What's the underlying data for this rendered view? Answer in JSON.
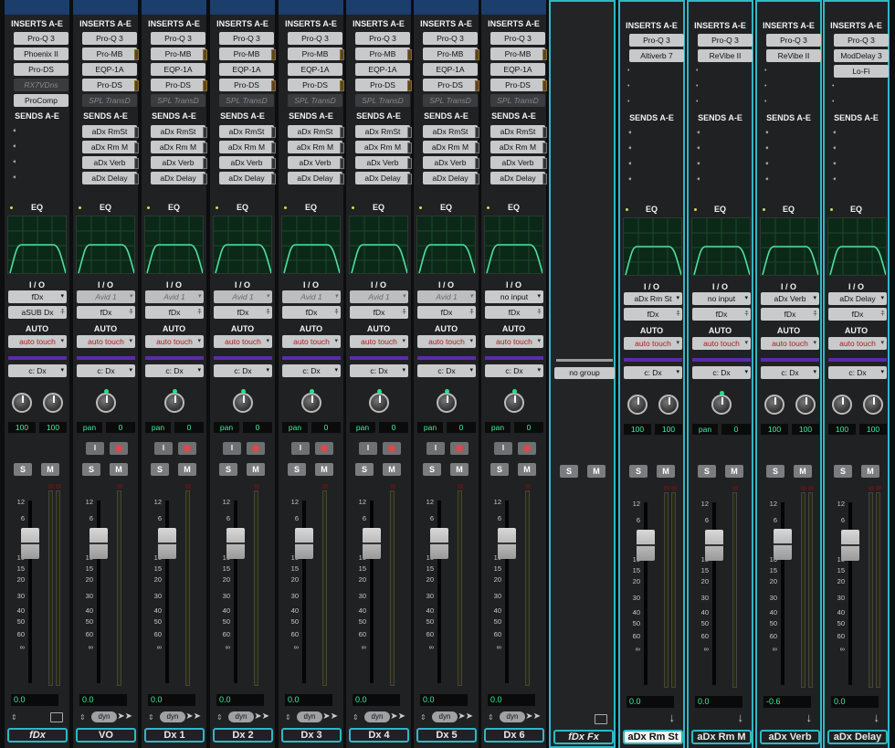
{
  "labels": {
    "inserts": "INSERTS A-E",
    "sends": "SENDS A-E",
    "eq": "EQ",
    "io": "I / O",
    "auto": "AUTO",
    "auto_mode": "auto touch",
    "vca": "c: Dx",
    "pan": "pan",
    "pan_val": "0",
    "lr": "100",
    "solo": "S",
    "mute": "M",
    "input": "I",
    "dyn": "dyn",
    "group": "no group"
  },
  "scale_ticks": [
    "12",
    "6",
    "0",
    "5",
    "10",
    "15",
    "20",
    "30",
    "40",
    "50",
    "60",
    "∞"
  ],
  "strips": [
    {
      "name": "fDx",
      "inserts": [
        "Pro-Q 3",
        "Phoenix II",
        "Pro-DS",
        "RX7VDns",
        "ProComp"
      ],
      "ins_off": [
        false,
        false,
        false,
        true,
        false
      ],
      "sends": [],
      "io_in": "fDx",
      "io_out": "aSUB Dx",
      "io_in_dis": false,
      "stereo": true,
      "vol": "0.0",
      "fader": 0.0
    },
    {
      "name": "VO",
      "inserts": [
        "Pro-Q 3",
        "Pro-MB",
        "EQP-1A",
        "Pro-DS",
        "SPL TransD"
      ],
      "ins_off": [
        false,
        false,
        false,
        false,
        true
      ],
      "sends": [
        "aDx RmSt",
        "aDx Rm M",
        "aDx Verb",
        "aDx Delay"
      ],
      "io_in": "Avid 1",
      "io_out": "fDx",
      "io_in_dis": true,
      "stereo": false,
      "vol": "0.0",
      "fader": 0.0
    },
    {
      "name": "Dx 1",
      "inserts": [
        "Pro-Q 3",
        "Pro-MB",
        "EQP-1A",
        "Pro-DS",
        "SPL TransD"
      ],
      "ins_off": [
        false,
        false,
        false,
        false,
        true
      ],
      "sends": [
        "aDx RmSt",
        "aDx Rm M",
        "aDx Verb",
        "aDx Delay"
      ],
      "io_in": "Avid 1",
      "io_out": "fDx",
      "io_in_dis": true,
      "stereo": false,
      "vol": "0.0",
      "fader": 0.0
    },
    {
      "name": "Dx 2",
      "inserts": [
        "Pro-Q 3",
        "Pro-MB",
        "EQP-1A",
        "Pro-DS",
        "SPL TransD"
      ],
      "ins_off": [
        false,
        false,
        false,
        false,
        true
      ],
      "sends": [
        "aDx RmSt",
        "aDx Rm M",
        "aDx Verb",
        "aDx Delay"
      ],
      "io_in": "Avid 1",
      "io_out": "fDx",
      "io_in_dis": true,
      "stereo": false,
      "vol": "0.0",
      "fader": 0.0
    },
    {
      "name": "Dx 3",
      "inserts": [
        "Pro-Q 3",
        "Pro-MB",
        "EQP-1A",
        "Pro-DS",
        "SPL TransD"
      ],
      "ins_off": [
        false,
        false,
        false,
        false,
        true
      ],
      "sends": [
        "aDx RmSt",
        "aDx Rm M",
        "aDx Verb",
        "aDx Delay"
      ],
      "io_in": "Avid 1",
      "io_out": "fDx",
      "io_in_dis": true,
      "stereo": false,
      "vol": "0.0",
      "fader": 0.0
    },
    {
      "name": "Dx 4",
      "inserts": [
        "Pro-Q 3",
        "Pro-MB",
        "EQP-1A",
        "Pro-DS",
        "SPL TransD"
      ],
      "ins_off": [
        false,
        false,
        false,
        false,
        true
      ],
      "sends": [
        "aDx RmSt",
        "aDx Rm M",
        "aDx Verb",
        "aDx Delay"
      ],
      "io_in": "Avid 1",
      "io_out": "fDx",
      "io_in_dis": true,
      "stereo": false,
      "vol": "0.0",
      "fader": 0.0
    },
    {
      "name": "Dx 5",
      "inserts": [
        "Pro-Q 3",
        "Pro-MB",
        "EQP-1A",
        "Pro-DS",
        "SPL TransD"
      ],
      "ins_off": [
        false,
        false,
        false,
        false,
        true
      ],
      "sends": [
        "aDx RmSt",
        "aDx Rm M",
        "aDx Verb",
        "aDx Delay"
      ],
      "io_in": "Avid 1",
      "io_out": "fDx",
      "io_in_dis": true,
      "stereo": false,
      "vol": "0.0",
      "fader": 0.0
    },
    {
      "name": "Dx 6",
      "inserts": [
        "Pro-Q 3",
        "Pro-MB",
        "EQP-1A",
        "Pro-DS",
        "SPL TransD"
      ],
      "ins_off": [
        false,
        false,
        false,
        false,
        true
      ],
      "sends": [
        "aDx RmSt",
        "aDx Rm M",
        "aDx Verb",
        "aDx Delay"
      ],
      "io_in": "no input",
      "io_out": "fDx",
      "io_in_dis": false,
      "stereo": false,
      "vol": "0.0",
      "fader": 0.0
    },
    {
      "name": "fDx Fx",
      "folder": true
    },
    {
      "name": "aDx Rm St",
      "inserts": [
        "Pro-Q 3",
        "Altiverb 7"
      ],
      "ins_off": [
        false,
        false
      ],
      "sends": [],
      "io_in": "aDx Rm St",
      "io_out": "fDx",
      "io_in_dis": false,
      "stereo": true,
      "vol": "0.0",
      "fader": 0.0,
      "highlight": true
    },
    {
      "name": "aDx Rm M",
      "inserts": [
        "Pro-Q 3",
        "ReVibe II"
      ],
      "ins_off": [
        false,
        false
      ],
      "sends": [],
      "io_in": "no input",
      "io_out": "fDx",
      "io_in_dis": false,
      "stereo": false,
      "vol": "0.0",
      "fader": 0.0
    },
    {
      "name": "aDx Verb",
      "inserts": [
        "Pro-Q 3",
        "ReVibe II"
      ],
      "ins_off": [
        false,
        false
      ],
      "sends": [],
      "io_in": "aDx Verb",
      "io_out": "fDx",
      "io_in_dis": false,
      "stereo": true,
      "vol": "-0.6",
      "fader": -0.6
    },
    {
      "name": "aDx Delay",
      "inserts": [
        "Pro-Q 3",
        "ModDelay 3",
        "Lo-Fi"
      ],
      "ins_off": [
        false,
        false,
        false
      ],
      "sends": [],
      "io_in": "aDx Delay",
      "io_out": "fDx",
      "io_in_dis": false,
      "stereo": true,
      "vol": "0.0",
      "fader": 0.0
    }
  ]
}
